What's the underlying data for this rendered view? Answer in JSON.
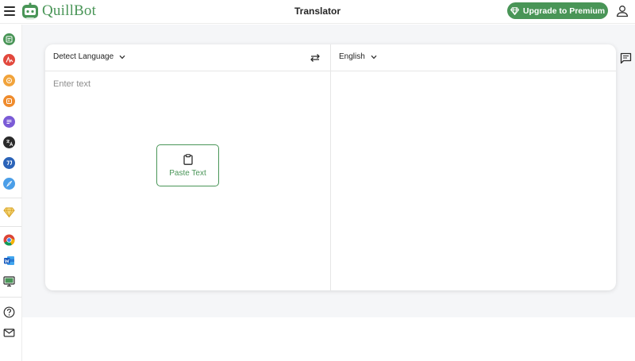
{
  "header": {
    "brand": "QuillBot",
    "title": "Translator",
    "premium_label": "Upgrade to Premium"
  },
  "sidebar": {
    "items": [
      {
        "icon": "paraphraser-icon",
        "color": "#499557"
      },
      {
        "icon": "grammar-checker-icon",
        "color": "#e2483d"
      },
      {
        "icon": "plagiarism-checker-icon",
        "color": "#f1a33b"
      },
      {
        "icon": "ai-detector-icon",
        "color": "#ef8b2c"
      },
      {
        "icon": "summarizer-icon",
        "color": "#7b5bd6"
      },
      {
        "icon": "translator-icon",
        "color": "#2a2a2a"
      },
      {
        "icon": "citation-generator-icon",
        "color": "#2b63b8"
      },
      {
        "icon": "co-writer-icon",
        "color": "#4a9ee8"
      },
      {
        "icon": "premium-diamond-icon",
        "color": "#e8b93b"
      },
      {
        "icon": "chrome-extension-icon",
        "color": "#db4437"
      },
      {
        "icon": "word-addin-icon",
        "color": "#2b579a"
      },
      {
        "icon": "desktop-app-icon",
        "color": "#499557"
      },
      {
        "icon": "help-icon",
        "color": "#2a2a2a"
      },
      {
        "icon": "mail-icon",
        "color": "#2a2a2a"
      }
    ]
  },
  "translator": {
    "source_language": "Detect Language",
    "target_language": "English",
    "input_placeholder": "Enter text",
    "input_value": "",
    "paste_label": "Paste Text"
  },
  "colors": {
    "brand": "#499557",
    "background": "#f5f6f8"
  }
}
